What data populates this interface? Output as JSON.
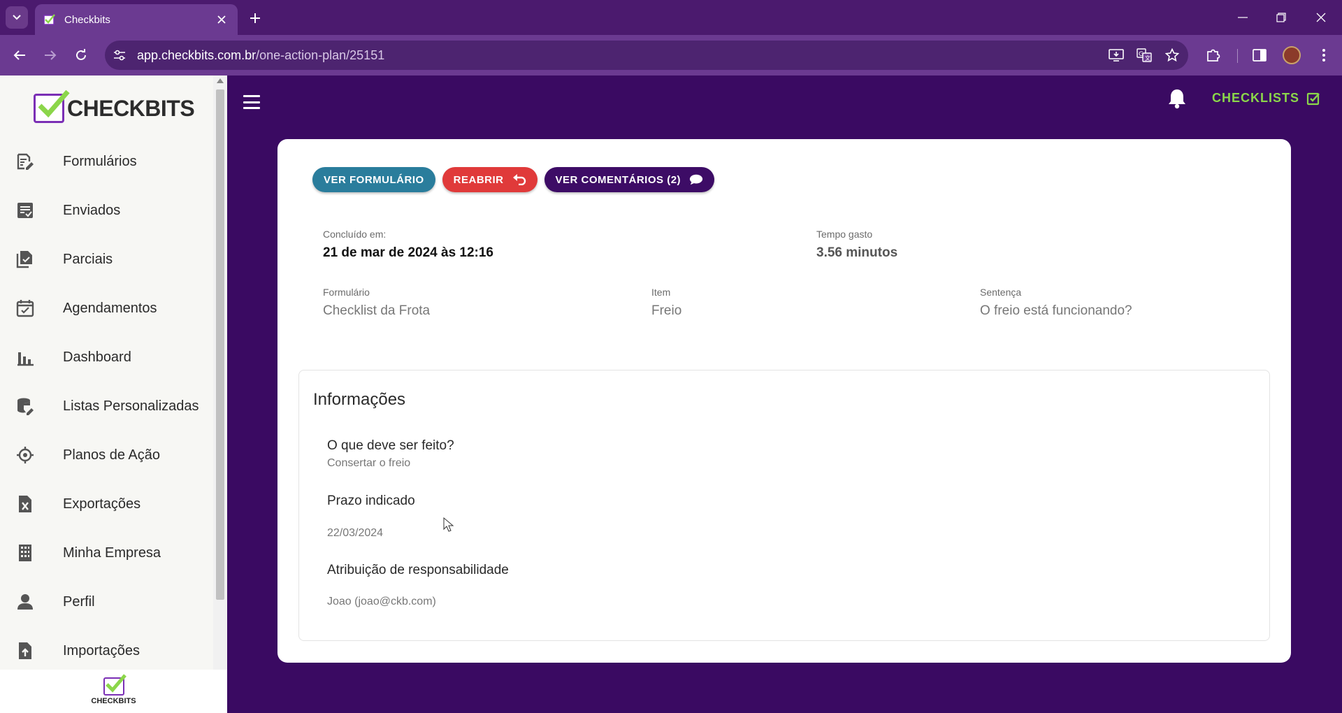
{
  "browser": {
    "tab_title": "Checkbits",
    "url_host": "app.checkbits.com.br",
    "url_path": "/one-action-plan/25151"
  },
  "sidebar": {
    "logo_text": "CHECKBITS",
    "footer_logo_text": "CHECKBITS",
    "items": [
      {
        "label": "Formulários",
        "icon": "form-edit-icon"
      },
      {
        "label": "Enviados",
        "icon": "sent-list-icon"
      },
      {
        "label": "Parciais",
        "icon": "partial-docs-icon"
      },
      {
        "label": "Agendamentos",
        "icon": "calendar-check-icon"
      },
      {
        "label": "Dashboard",
        "icon": "bar-chart-icon"
      },
      {
        "label": "Listas Personalizadas",
        "icon": "database-edit-icon"
      },
      {
        "label": "Planos de Ação",
        "icon": "crosshair-icon"
      },
      {
        "label": "Exportações",
        "icon": "excel-file-icon"
      },
      {
        "label": "Minha Empresa",
        "icon": "building-icon"
      },
      {
        "label": "Perfil",
        "icon": "person-icon"
      },
      {
        "label": "Importações",
        "icon": "file-upload-icon"
      }
    ]
  },
  "header": {
    "checklists_label": "CHECKLISTS"
  },
  "actions": {
    "view_form": "VER FORMULÁRIO",
    "reopen": "REABRIR",
    "comments": "VER COMENTÁRIOS (2)"
  },
  "summary": {
    "concluded_label": "Concluído em:",
    "concluded_value": "21 de mar de 2024 às 12:16",
    "time_label": "Tempo gasto",
    "time_value": "3.56 minutos",
    "form_label": "Formulário",
    "form_value": "Checklist da Frota",
    "item_label": "Item",
    "item_value": "Freio",
    "sentence_label": "Sentença",
    "sentence_value": "O freio está funcionando?"
  },
  "info": {
    "title": "Informações",
    "what_label": "O que deve ser feito?",
    "what_value": "Consertar o freio",
    "deadline_label": "Prazo indicado",
    "deadline_value": "22/03/2024",
    "assign_label": "Atribuição de responsabilidade",
    "assign_value": "Joao (joao@ckb.com)"
  },
  "colors": {
    "page_bg": "#3a0a62",
    "chrome": "#6b3a91",
    "accent_green": "#8bd64a",
    "btn_form": "#2a7d9c",
    "btn_reopen": "#e03a3a",
    "btn_comments": "#3d0c66"
  }
}
